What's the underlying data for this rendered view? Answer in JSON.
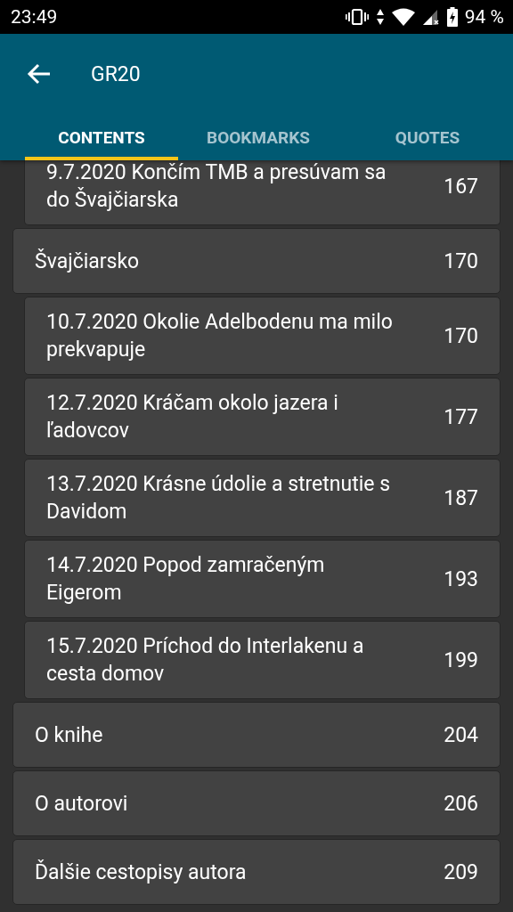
{
  "status_bar": {
    "time": "23:49",
    "battery": "94 %"
  },
  "app_bar": {
    "title": "GR20"
  },
  "tabs": [
    {
      "label": "CONTENTS",
      "selected": true
    },
    {
      "label": "BOOKMARKS",
      "selected": false
    },
    {
      "label": "QUOTES",
      "selected": false
    }
  ],
  "contents": [
    {
      "children": [
        {
          "title": "9.7.2020 Končím TMB a presúvam sa do Švajčiarska",
          "page": "167"
        }
      ]
    },
    {
      "title": "Švajčiarsko",
      "page": "170",
      "children": [
        {
          "title": "10.7.2020 Okolie Adelbodenu ma milo prekvapuje",
          "page": "170"
        },
        {
          "title": "12.7.2020 Kráčam okolo jazera i ľadovcov",
          "page": "177"
        },
        {
          "title": "13.7.2020 Krásne údolie a stretnutie s Davidom",
          "page": "187"
        },
        {
          "title": "14.7.2020 Popod zamračeným Eigerom",
          "page": "193"
        },
        {
          "title": "15.7.2020 Príchod do Interlakenu a cesta domov",
          "page": "199"
        }
      ]
    },
    {
      "title": "O knihe",
      "page": "204"
    },
    {
      "title": "O autorovi",
      "page": "206"
    },
    {
      "title": "Ďalšie cestopisy autora",
      "page": "209"
    }
  ]
}
